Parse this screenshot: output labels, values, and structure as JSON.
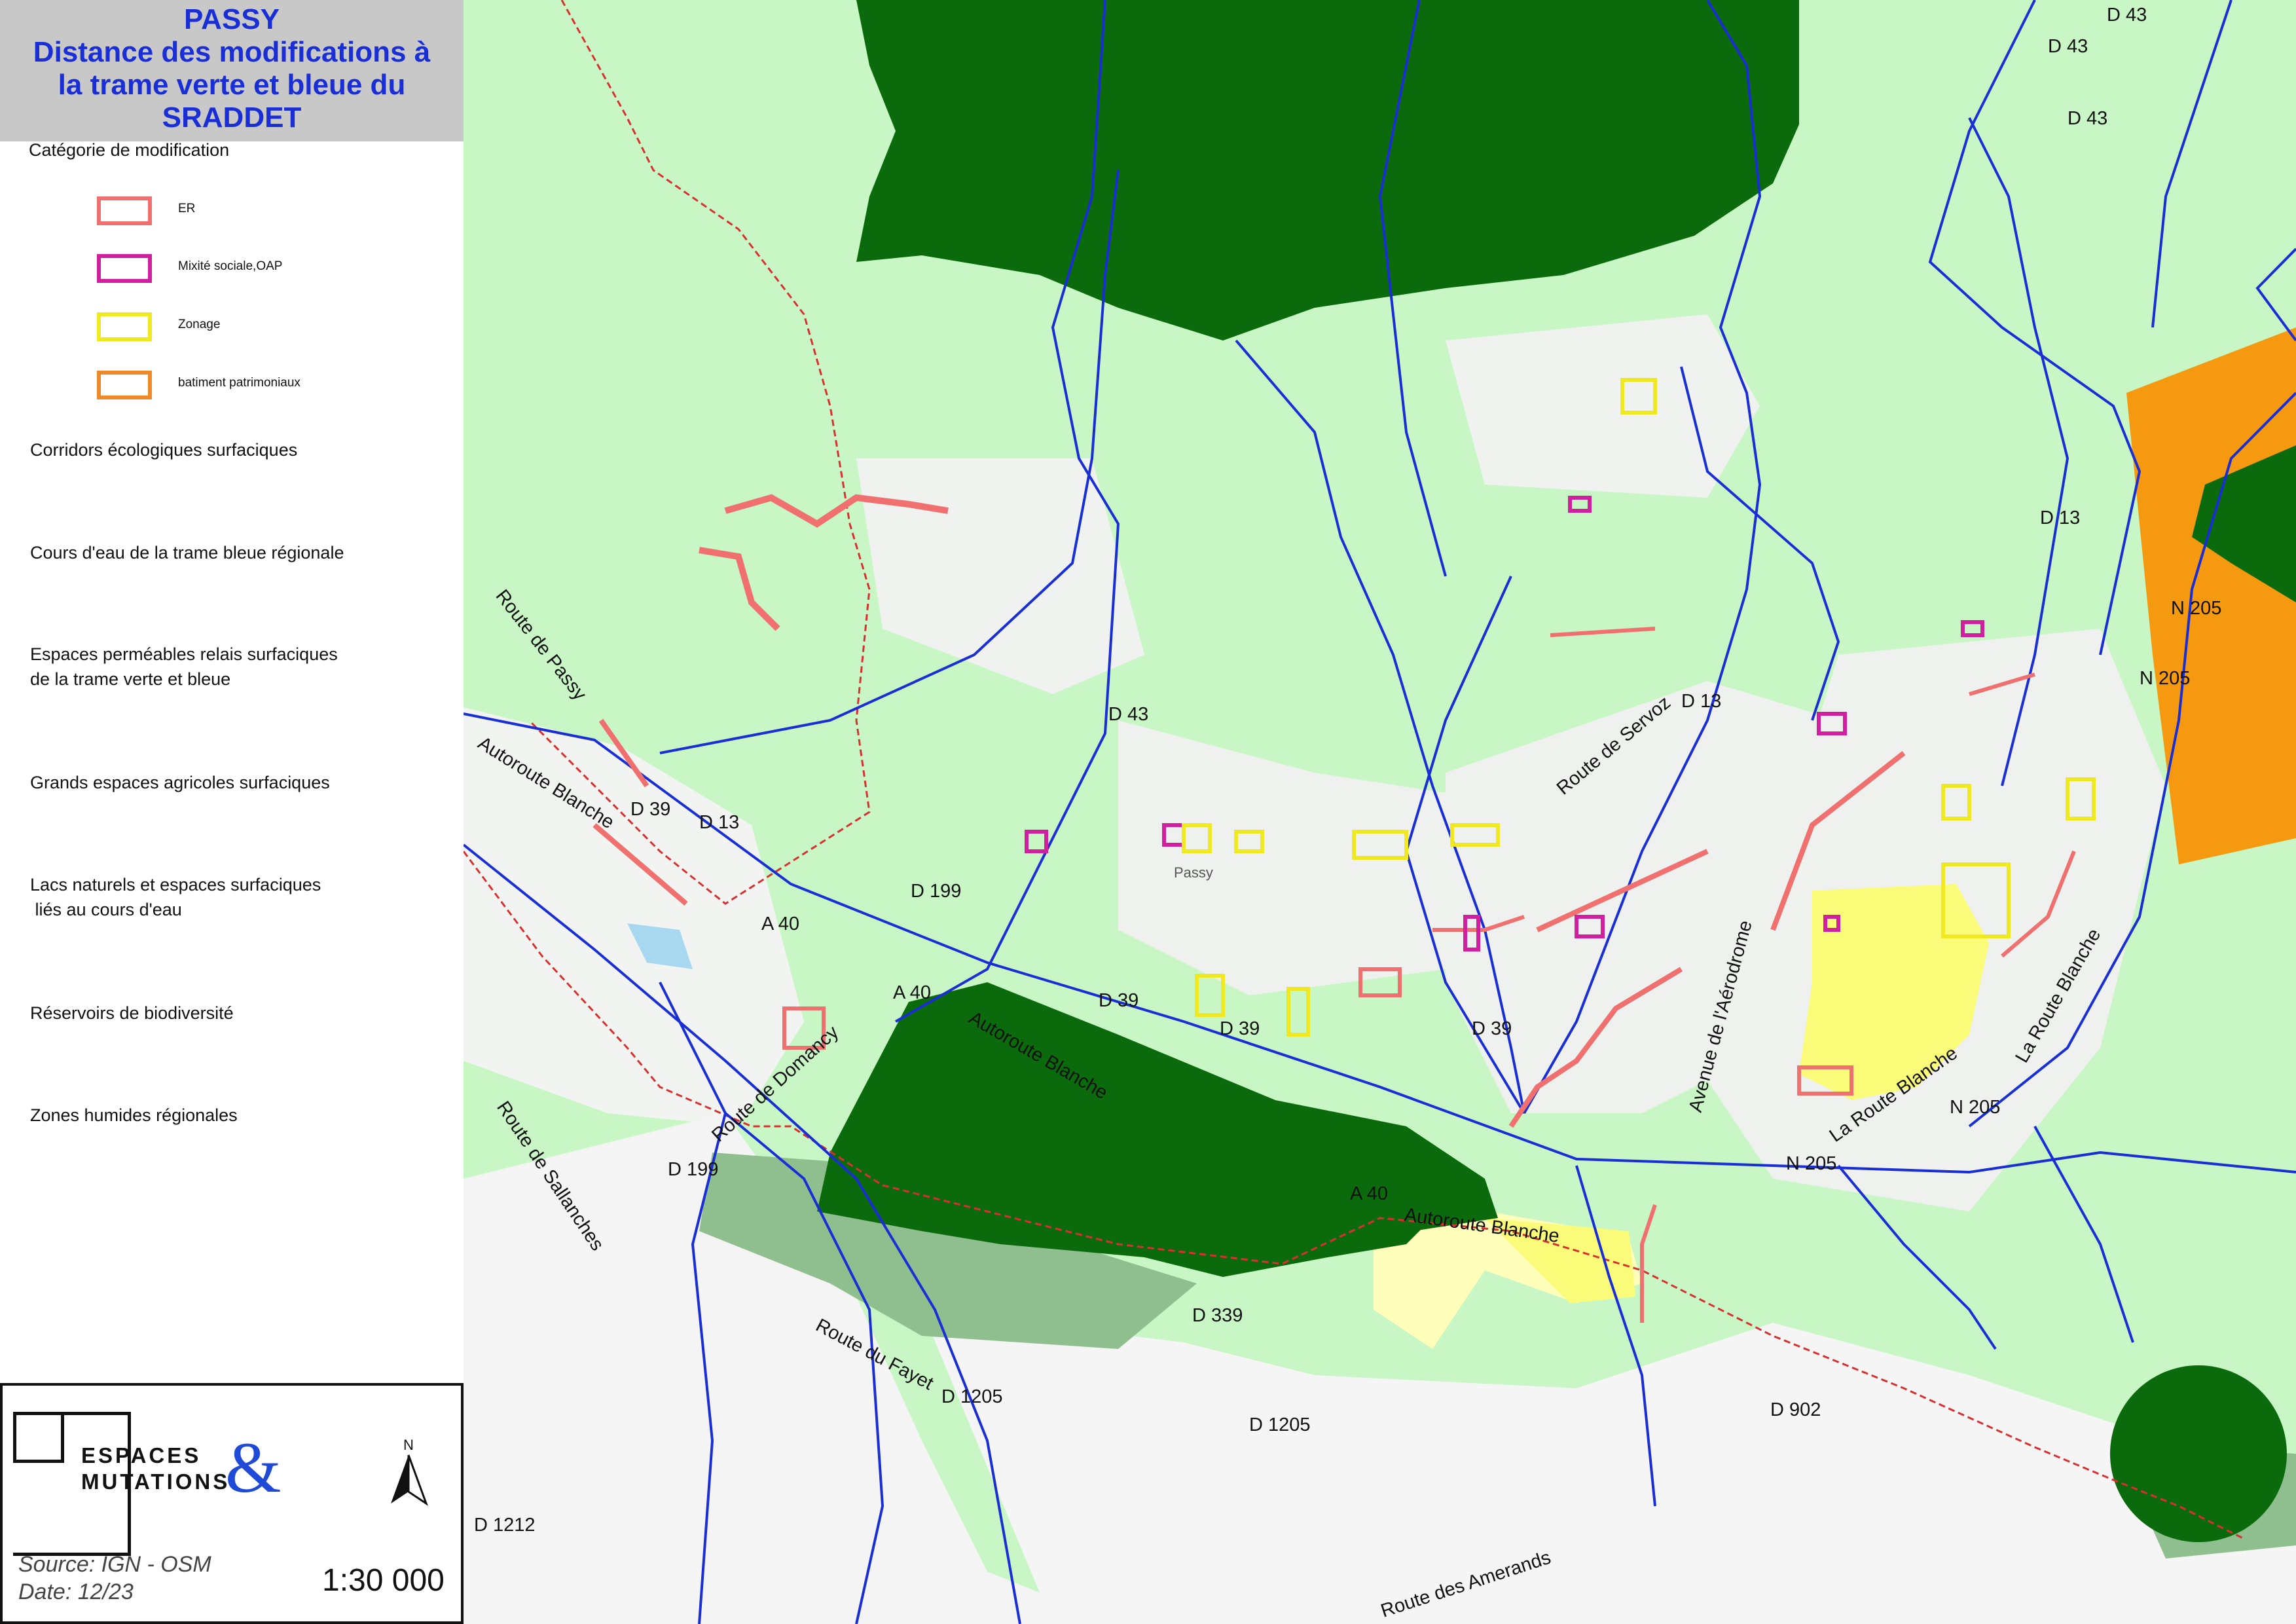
{
  "title": {
    "lines": [
      "PASSY",
      "Distance des modifications à",
      "la trame verte et bleue du",
      "SRADDET"
    ],
    "color": "#1a2ed6"
  },
  "legend": {
    "category_title": "Catégorie de modification",
    "categories": [
      {
        "label": "ER",
        "color": "#f07070"
      },
      {
        "label": "Mixité sociale,OAP",
        "color": "#d020a0"
      },
      {
        "label": "Zonage",
        "color": "#f0e820"
      },
      {
        "label": "batiment patrimoniaux",
        "color": "#f08a28"
      }
    ],
    "layers": [
      {
        "label": "Corridors écologiques surfaciques"
      },
      {
        "label": "Cours d'eau de la trame bleue régionale",
        "color": "#1a2ed6"
      },
      {
        "label": "Espaces perméables relais surfaciques\nde la trame verte et bleue",
        "color": "#c8f7c5"
      },
      {
        "label": "Grands espaces agricoles surfaciques",
        "color": "#ffff99"
      },
      {
        "label": "Lacs naturels et espaces surfaciques\n liés au cours d'eau",
        "color": "#a8d8f0"
      },
      {
        "label": "Réservoirs de biodiversité",
        "color": "#0b6a0b"
      },
      {
        "label": "Zones humides régionales",
        "color": "#8fbf8f"
      }
    ]
  },
  "logo": {
    "word1": "ESPACES",
    "word2": "MUTATIONS",
    "amp": "&",
    "amp_color": "#1f4ad8"
  },
  "north_label": "N",
  "source": "Source: IGN - OSM",
  "date": "Date: 12/23",
  "scale": "1:30 000",
  "map_labels": {
    "d43_a": "D 43",
    "d43_b": "D 43",
    "d43_c": "D 43",
    "d43_d": "D 43",
    "d13_a": "D 13",
    "d13_b": "D 13",
    "d13_c": "D 13",
    "n205_a": "N 205",
    "n205_b": "N 205",
    "n205_c": "N 205",
    "n205_d": "N 205",
    "route_passy": "Route de Passy",
    "autoroute_blanche_a": "Autoroute Blanche",
    "autoroute_blanche_b": "Autoroute Blanche",
    "autoroute_blanche_c": "Autoroute Blanche",
    "d39_a": "D 39",
    "d39_b": "D 39",
    "d39_c": "D 39",
    "d39_d": "D 39",
    "d199_a": "D 199",
    "d199_b": "D 199",
    "a40_a": "A 40",
    "a40_b": "A 40",
    "a40_c": "A 40",
    "route_servoz": "Route de Servoz",
    "avenue_aerodrome": "Avenue de l'Aérodrome",
    "la_route_blanche_a": "La Route Blanche",
    "la_route_blanche_b": "La Route Blanche",
    "route_domancy": "Route de Domancy",
    "route_sallanches": "Route de Sallanches",
    "route_fayet": "Route du Fayet",
    "d339": "D 339",
    "d1205_a": "D 1205",
    "d1205_b": "D 1205",
    "d902": "D 902",
    "d1212": "D 1212",
    "route_amerands": "Route des Amerands",
    "passy_town": "Passy"
  }
}
